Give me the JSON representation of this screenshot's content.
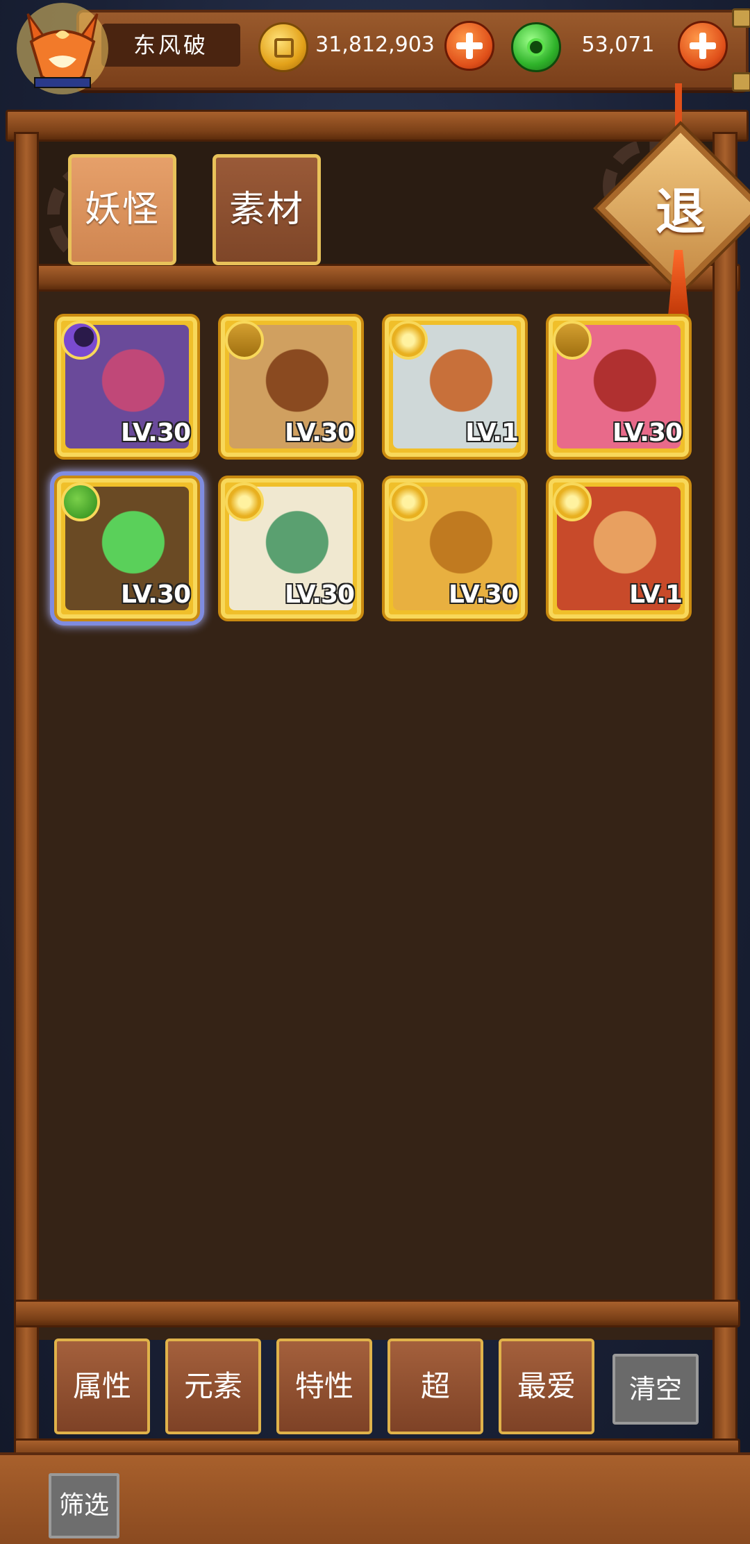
{
  "player": {
    "name": "东风破"
  },
  "currency": {
    "gold": "31,812,903",
    "jade": "53,071"
  },
  "tabs": [
    {
      "label": "妖怪",
      "active": true
    },
    {
      "label": "素材",
      "active": false
    }
  ],
  "retreat_label": "退",
  "monsters": [
    {
      "level": "LV.30",
      "element": "moon",
      "colors": [
        "#6a4a9a",
        "#c04878"
      ]
    },
    {
      "level": "LV.30",
      "element": "earth",
      "colors": [
        "#d0a060",
        "#8a4a20"
      ]
    },
    {
      "level": "LV.1",
      "element": "sun",
      "colors": [
        "#cfd8d8",
        "#c8703a"
      ]
    },
    {
      "level": "LV.30",
      "element": "earth",
      "colors": [
        "#e86a8a",
        "#b03030"
      ]
    },
    {
      "level": "LV.30",
      "element": "wood",
      "colors": [
        "#6a4a24",
        "#5ad05a"
      ],
      "selected": true
    },
    {
      "level": "LV.30",
      "element": "sun",
      "colors": [
        "#f0e8d0",
        "#5aa070"
      ]
    },
    {
      "level": "LV.30",
      "element": "sun",
      "colors": [
        "#e8b040",
        "#c07a20"
      ]
    },
    {
      "level": "LV.1",
      "element": "sun",
      "colors": [
        "#c84a2a",
        "#e8a060"
      ]
    }
  ],
  "filters": [
    "属性",
    "元素",
    "特性",
    "超",
    "最爱"
  ],
  "clear_label": "清空",
  "filter_label": "筛选",
  "colors": {
    "wood": "#7c4118",
    "panel": "#352316",
    "card_gold": "#f0bf2a",
    "plus": "#e0501a"
  }
}
